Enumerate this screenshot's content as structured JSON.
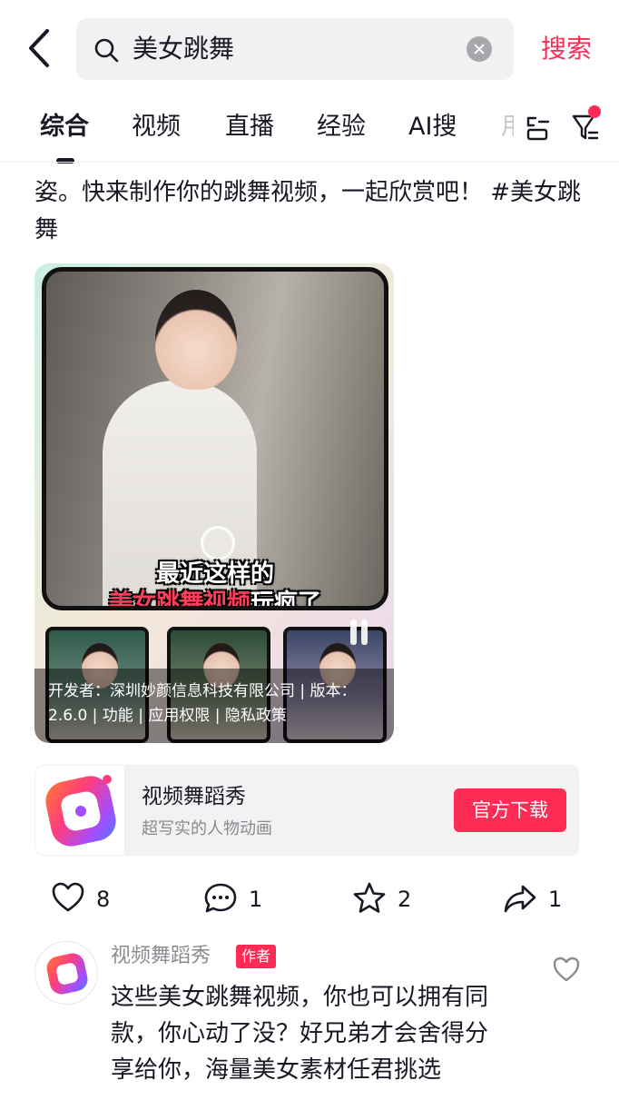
{
  "search": {
    "query": "美女跳舞",
    "button_label": "搜索"
  },
  "tabs": [
    {
      "label": "综合",
      "active": true
    },
    {
      "label": "视频"
    },
    {
      "label": "直播"
    },
    {
      "label": "经验"
    },
    {
      "label": "AI搜"
    },
    {
      "label": "用"
    }
  ],
  "post": {
    "text": "姿。快来制作你的跳舞视频，一起欣赏吧！ #美女跳舞"
  },
  "ad": {
    "caption_line1": "最近这样的",
    "caption_line2_highlight": "美女跳舞视频",
    "caption_line2_rest": "玩疯了",
    "developer_info": "开发者：深圳妙颜信息科技有限公司 | 版本：2.6.0 | 功能 | 应用权限 | 隐私政策"
  },
  "app_card": {
    "name": "视频舞蹈秀",
    "subtitle": "超写实的人物动画",
    "download_label": "官方下载"
  },
  "actions": {
    "like_count": "8",
    "comment_count": "1",
    "favorite_count": "2",
    "share_count": "1"
  },
  "comment": {
    "username": "视频舞蹈秀",
    "badge": "作者",
    "text": "这些美女跳舞视频，你也可以拥有同款，你心动了没？好兄弟才会舍得分享给你，海量美女素材任君挑选"
  },
  "colors": {
    "accent": "#fe2c55",
    "text": "#161823",
    "secondary_text": "#8a8b91"
  }
}
